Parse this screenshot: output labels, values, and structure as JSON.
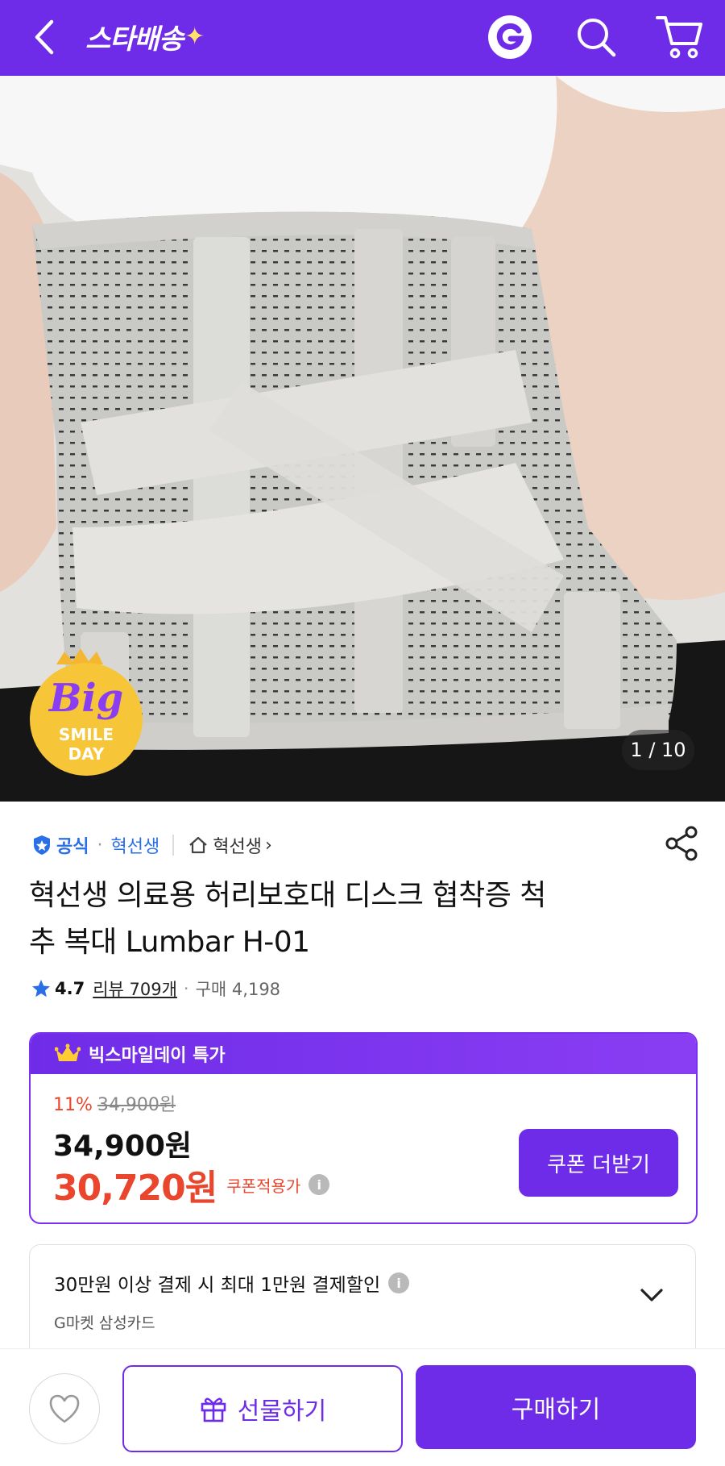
{
  "header": {
    "logo_text": "스타배송",
    "logo_spark": "✦",
    "icons": [
      "back-arrow-icon",
      "g-logo-icon",
      "search-icon",
      "cart-icon"
    ]
  },
  "gallery": {
    "counter": "1 / 10",
    "badge": {
      "line1": "Big",
      "line2": "SMILE",
      "line3": "DAY"
    }
  },
  "meta": {
    "official_label": "공식",
    "seller": "혁선생",
    "store_label": "혁선생",
    "store_chevron": "›"
  },
  "product": {
    "title_line1": "혁선생 의료용 허리보호대 디스크 협착증 척",
    "title_line2": "추 복대 Lumbar H-01",
    "rating": "4.7",
    "review_label": "리뷰 709개",
    "buy_separator": "·",
    "buy_label": "구매 4,198"
  },
  "promo": {
    "header": "빅스마일데이 특가",
    "discount_rate": "11%",
    "original_price": "34,900원",
    "price": "34,900원",
    "coupon_price": "30,720원",
    "coupon_label": "쿠폰적용가",
    "coupon_button": "쿠폰 더받기",
    "info_glyph": "i"
  },
  "card_benefit": {
    "main": "30만원 이상 결제 시 최대 1만원 결제할인",
    "sub": "G마켓 삼성카드",
    "info_glyph": "i"
  },
  "bottom": {
    "gift_label": "선물하기",
    "buy_label": "구매하기"
  },
  "colors": {
    "brand": "#6f2ce8",
    "sale_red": "#e9462d",
    "link_blue": "#2a6fe8"
  }
}
